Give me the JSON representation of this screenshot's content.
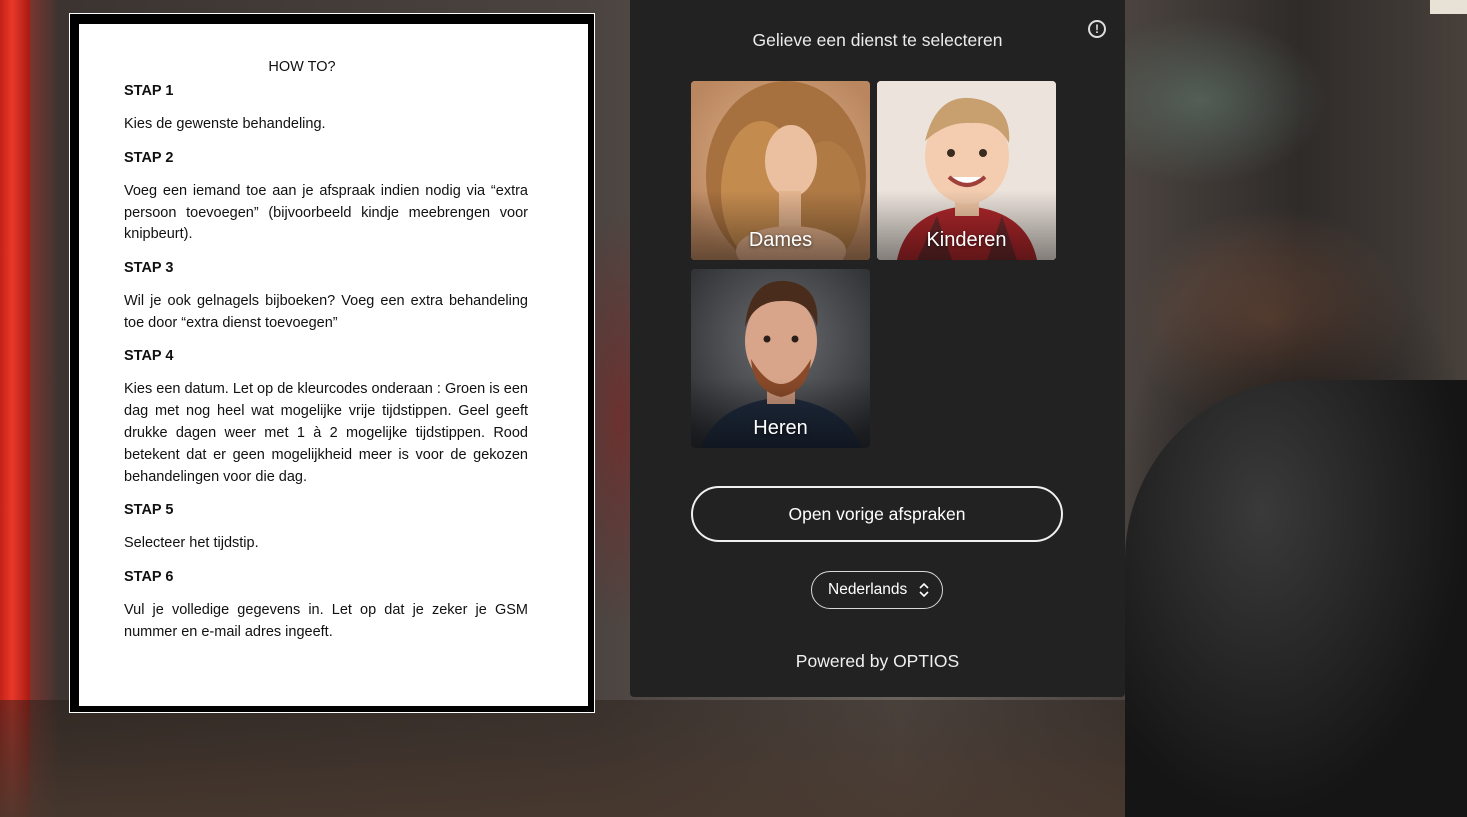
{
  "instructions": {
    "title": "HOW TO?",
    "steps": [
      {
        "heading": "STAP 1",
        "text": "Kies de gewenste behandeling."
      },
      {
        "heading": "STAP 2",
        "text": "Voeg een iemand toe aan je afspraak indien nodig via “extra persoon toevoegen” (bijvoorbeeld kindje meebrengen voor knipbeurt)."
      },
      {
        "heading": "STAP 3",
        "text": "Wil je ook gelnagels bijboeken? Voeg een extra behandeling toe door “extra dienst toevoegen”"
      },
      {
        "heading": "STAP 4",
        "text": "Kies een datum. Let op de kleurcodes onderaan : Groen is een dag met nog heel wat mogelijke vrije tijdstippen. Geel geeft drukke dagen weer met 1 à 2 mogelijke tijdstippen. Rood betekent dat er geen mogelijkheid meer is voor de gekozen behandelingen voor die dag."
      },
      {
        "heading": "STAP 5",
        "text": "Selecteer het tijdstip."
      },
      {
        "heading": "STAP 6",
        "text": "Vul je volledige gegevens in.  Let op dat je zeker je GSM nummer en e-mail adres ingeeft."
      }
    ]
  },
  "widget": {
    "title": "Gelieve een dienst te selecteren",
    "info_icon": "info-circle-icon",
    "services": [
      {
        "label": "Dames"
      },
      {
        "label": "Kinderen"
      },
      {
        "label": "Heren"
      }
    ],
    "previous_button": "Open vorige afspraken",
    "language": {
      "selected": "Nederlands",
      "icon": "up-down-chevron-icon"
    },
    "powered_by": "Powered by OPTIOS"
  },
  "colors": {
    "panel_bg": "#222222",
    "text": "#ffffff",
    "frame_red": "#e8382a"
  }
}
